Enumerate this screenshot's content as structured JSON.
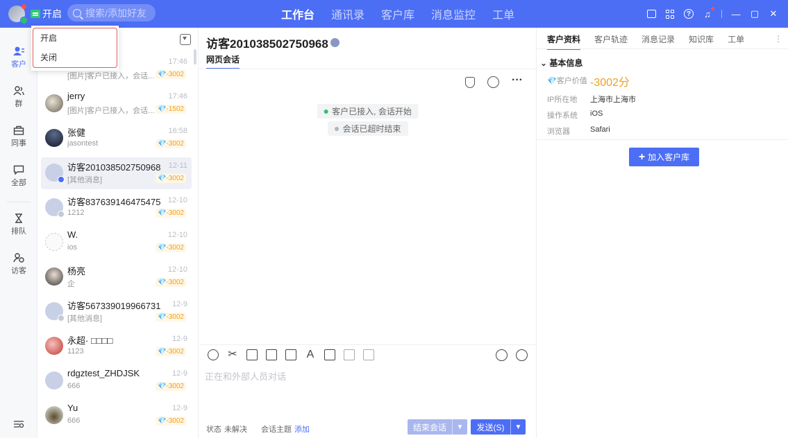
{
  "topbar": {
    "status_label": "开启",
    "search_placeholder": "搜索/添加好友",
    "nav": [
      "工作台",
      "通讯录",
      "客户库",
      "消息监控",
      "工单"
    ]
  },
  "status_dropdown": {
    "options": [
      "开启",
      "关闭"
    ]
  },
  "left_rail": {
    "items": [
      {
        "label": "客户",
        "icon": "customer-icon"
      },
      {
        "label": "群",
        "icon": "group-icon"
      },
      {
        "label": "同事",
        "icon": "colleague-icon"
      },
      {
        "label": "全部",
        "icon": "message-icon"
      },
      {
        "label": "排队",
        "icon": "hourglass-icon"
      },
      {
        "label": "访客",
        "icon": "visitor-icon"
      }
    ]
  },
  "sessions": [
    {
      "name": "",
      "time": "17:46",
      "preview": "[图片]客户已接入，会话...",
      "value": "💎-3002"
    },
    {
      "name": "jerry",
      "time": "17:46",
      "preview": "[图片]客户已接入，会话...",
      "value": "💎-1502"
    },
    {
      "name": "张健",
      "time": "16:58",
      "preview": "jasontest",
      "value": "💎-3002"
    },
    {
      "name": "访客201038502750968",
      "time": "12-11",
      "preview": "[其他消息]",
      "value": "💎-3002"
    },
    {
      "name": "访客837639146475475",
      "time": "12-10",
      "preview": "1212",
      "value": "💎-3002"
    },
    {
      "name": "W.",
      "time": "12-10",
      "preview": "ios",
      "value": "💎-3002"
    },
    {
      "name": "杨亮",
      "time": "12-10",
      "preview": "企",
      "value": "💎-3002"
    },
    {
      "name": "访客567339019966731",
      "time": "12-9",
      "preview": "[其他消息]",
      "value": "💎-3002"
    },
    {
      "name": "永超· □□□□",
      "time": "12-9",
      "preview": "1123",
      "value": "💎-3002"
    },
    {
      "name": "rdgztest_ZHDJSK",
      "time": "12-9",
      "preview": "666",
      "value": "💎-3002"
    },
    {
      "name": "Yu",
      "time": "12-9",
      "preview": "666",
      "value": "💎-3002"
    }
  ],
  "chat": {
    "title": "访客201038502750968",
    "tab": "网页会话",
    "system_messages": [
      "客户已接入, 会话开始",
      "会话已超时结束"
    ],
    "input_placeholder": "正在和外部人员对话",
    "status_label": "状态",
    "status_value": "未解决",
    "topic_label": "会话主题",
    "topic_add": "添加",
    "end_button": "结束会话",
    "send_button": "发送(S)"
  },
  "right_panel": {
    "tabs": [
      "客户资料",
      "客户轨迹",
      "消息记录",
      "知识库",
      "工单"
    ],
    "section_title": "基本信息",
    "fields": [
      {
        "key": "💎客户价值",
        "value": "-3002分"
      },
      {
        "key": "IP所在地",
        "value": "上海市上海市"
      },
      {
        "key": "操作系统",
        "value": "iOS"
      },
      {
        "key": "浏览器",
        "value": "Safari"
      }
    ],
    "add_button": "加入客户库"
  },
  "colors": {
    "brand": "#4c6ef5",
    "value": "#f0a020",
    "online": "#27c46b",
    "dropdown_highlight": "#e05a5a"
  }
}
